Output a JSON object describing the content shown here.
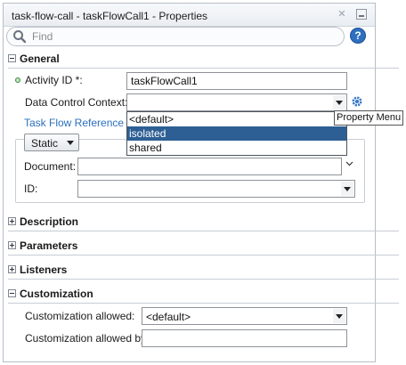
{
  "window": {
    "title": "task-flow-call - taskFlowCall1 - Properties"
  },
  "search": {
    "placeholder": "Find",
    "value": ""
  },
  "general": {
    "header": "General",
    "activity_id_label": "Activity ID *:",
    "activity_id_value": "taskFlowCall1",
    "data_control_label": "Data Control Context:",
    "data_control_value": "",
    "data_control_options": [
      "<default>",
      "isolated",
      "shared"
    ],
    "data_control_highlighted": "isolated",
    "tooltip": "Property Menu",
    "task_flow_reference": {
      "legend": "Task Flow Reference",
      "type_value": "Static",
      "document_label": "Document:",
      "document_value": "",
      "id_label": "ID:",
      "id_value": ""
    }
  },
  "sections": {
    "description": "Description",
    "parameters": "Parameters",
    "listeners": "Listeners",
    "customization": "Customization"
  },
  "customization": {
    "allowed_label": "Customization allowed:",
    "allowed_value": "<default>",
    "allowed_by_label": "Customization allowed by:",
    "allowed_by_value": ""
  },
  "colors": {
    "selection": "#2d5f94",
    "link": "#2a6fbf",
    "help": "#2f6fc0"
  },
  "icons": [
    "search-icon",
    "help-icon",
    "close-icon",
    "minimize-icon",
    "gear-icon",
    "chevron-down-icon"
  ]
}
